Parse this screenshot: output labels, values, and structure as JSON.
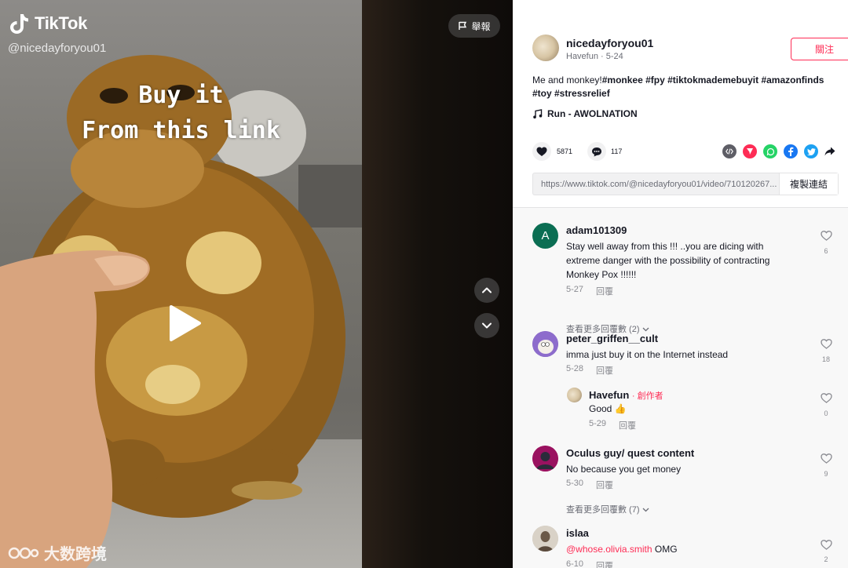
{
  "video": {
    "brand": "TikTok",
    "handle": "@nicedayforyou01",
    "overlay_line1": "Buy it",
    "overlay_line2": "From this link",
    "report_label": "舉報",
    "watermark": "大数跨境"
  },
  "author": {
    "username": "nicedayforyou01",
    "nickname_date": "Havefun · 5-24",
    "follow_label": "關注"
  },
  "caption": {
    "text": "Me and monkey!",
    "hashtags": "#monkee #fpy #tiktokmademebuyit #amazonfinds #toy #stressrelief"
  },
  "music": "Run - AWOLNATION",
  "stats": {
    "likes": "5871",
    "comments": "117"
  },
  "share": {
    "url": "https://www.tiktok.com/@nicedayforyou01/video/710120267...",
    "copy_label": "複製連結",
    "icons": [
      "embed-icon",
      "send-icon",
      "whatsapp-icon",
      "facebook-icon",
      "twitter-icon",
      "share-arrow-icon"
    ]
  },
  "comments": [
    {
      "avatar_letter": "A",
      "avatar_color": "#0b6e53",
      "username": "adam101309",
      "text": "Stay well away from this !!! ..you are dicing with extreme danger with the possibility of contracting Monkey Pox !!!!!!",
      "date": "5-27",
      "reply_label": "回覆",
      "likes": "6",
      "more_replies": "查看更多回覆數 (2)"
    },
    {
      "username": "peter_griffen__cult",
      "text": "imma just buy it on the Internet instead",
      "date": "5-28",
      "reply_label": "回覆",
      "likes": "18",
      "reply": {
        "username": "Havefun",
        "tag": "創作者",
        "text": "Good 👍",
        "date": "5-29",
        "reply_label": "回覆",
        "likes": "0"
      }
    },
    {
      "username": "Oculus guy/ quest content",
      "text": "No because you get money",
      "date": "5-30",
      "reply_label": "回覆",
      "likes": "9",
      "more_replies": "查看更多回覆數 (7)"
    },
    {
      "username": "islaa",
      "mention": "@whose.olivia.smith",
      "text": "OMG",
      "date": "6-10",
      "reply_label": "回覆",
      "likes": "2"
    }
  ],
  "colors": {
    "accent": "#fe2c55",
    "text": "#161823",
    "muted": "#8a8b91"
  }
}
